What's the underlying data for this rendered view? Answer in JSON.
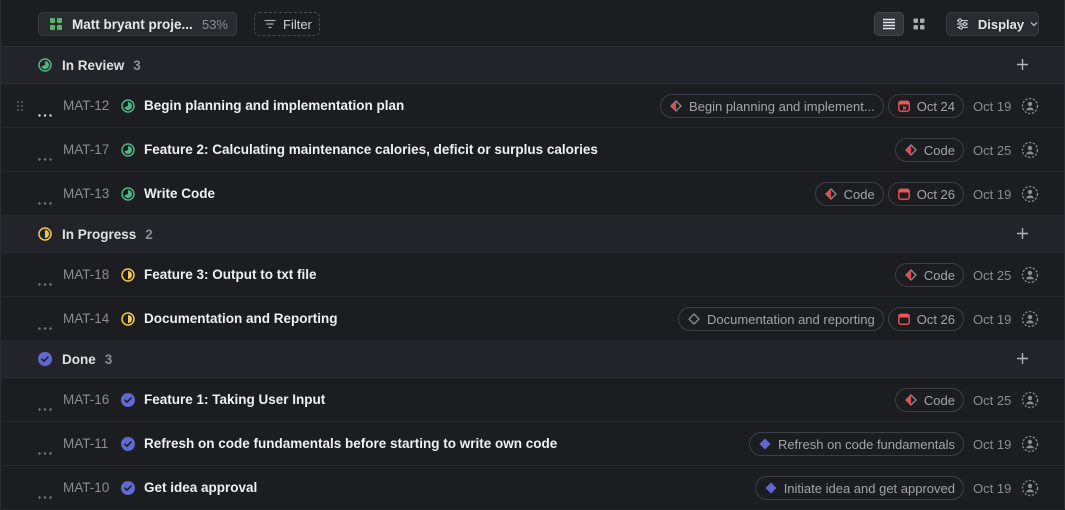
{
  "toolbar": {
    "project_name": "Matt bryant proje...",
    "project_progress": "53%",
    "filter_label": "Filter",
    "display_label": "Display",
    "active_view": "list"
  },
  "colors": {
    "in_review": "#4cb782",
    "in_progress": "#f2c94c",
    "done": "#5e6ad2",
    "due_date": "#eb5757",
    "milestone_red": "#e5484d"
  },
  "groups": [
    {
      "name": "In Review",
      "count": "3",
      "status": "in-review",
      "issues": [
        {
          "id": "MAT-12",
          "title": "Begin planning and implementation plan",
          "label": "Begin planning and implement...",
          "label_icon": "milestone-partial-icon",
          "due": "Oct 24",
          "due_overdue": true,
          "created": "Oct 19"
        },
        {
          "id": "MAT-17",
          "title": "Feature 2: Calculating maintenance calories, deficit or surplus calories",
          "label": "Code",
          "label_icon": "milestone-partial-icon",
          "due": "",
          "created": "Oct 25"
        },
        {
          "id": "MAT-13",
          "title": "Write Code",
          "label": "Code",
          "label_icon": "milestone-partial-icon",
          "due": "Oct 26",
          "due_overdue": false,
          "created": "Oct 19"
        }
      ]
    },
    {
      "name": "In Progress",
      "count": "2",
      "status": "in-progress",
      "issues": [
        {
          "id": "MAT-18",
          "title": "Feature 3: Output to txt file",
          "label": "Code",
          "label_icon": "milestone-partial-icon",
          "due": "",
          "created": "Oct 25"
        },
        {
          "id": "MAT-14",
          "title": "Documentation and Reporting",
          "label": "Documentation and reporting",
          "label_icon": "milestone-empty-icon",
          "due": "Oct 26",
          "due_overdue": false,
          "created": "Oct 19"
        }
      ]
    },
    {
      "name": "Done",
      "count": "3",
      "status": "done",
      "issues": [
        {
          "id": "MAT-16",
          "title": "Feature 1: Taking User Input",
          "label": "Code",
          "label_icon": "milestone-partial-icon",
          "due": "",
          "created": "Oct 25"
        },
        {
          "id": "MAT-11",
          "title": "Refresh on code fundamentals before starting to write own code",
          "label": "Refresh on code fundamentals",
          "label_icon": "milestone-complete-icon",
          "due": "",
          "created": "Oct 19"
        },
        {
          "id": "MAT-10",
          "title": "Get idea approval",
          "label": "Initiate idea and get approved",
          "label_icon": "milestone-complete-icon",
          "due": "",
          "created": "Oct 19"
        }
      ]
    }
  ]
}
